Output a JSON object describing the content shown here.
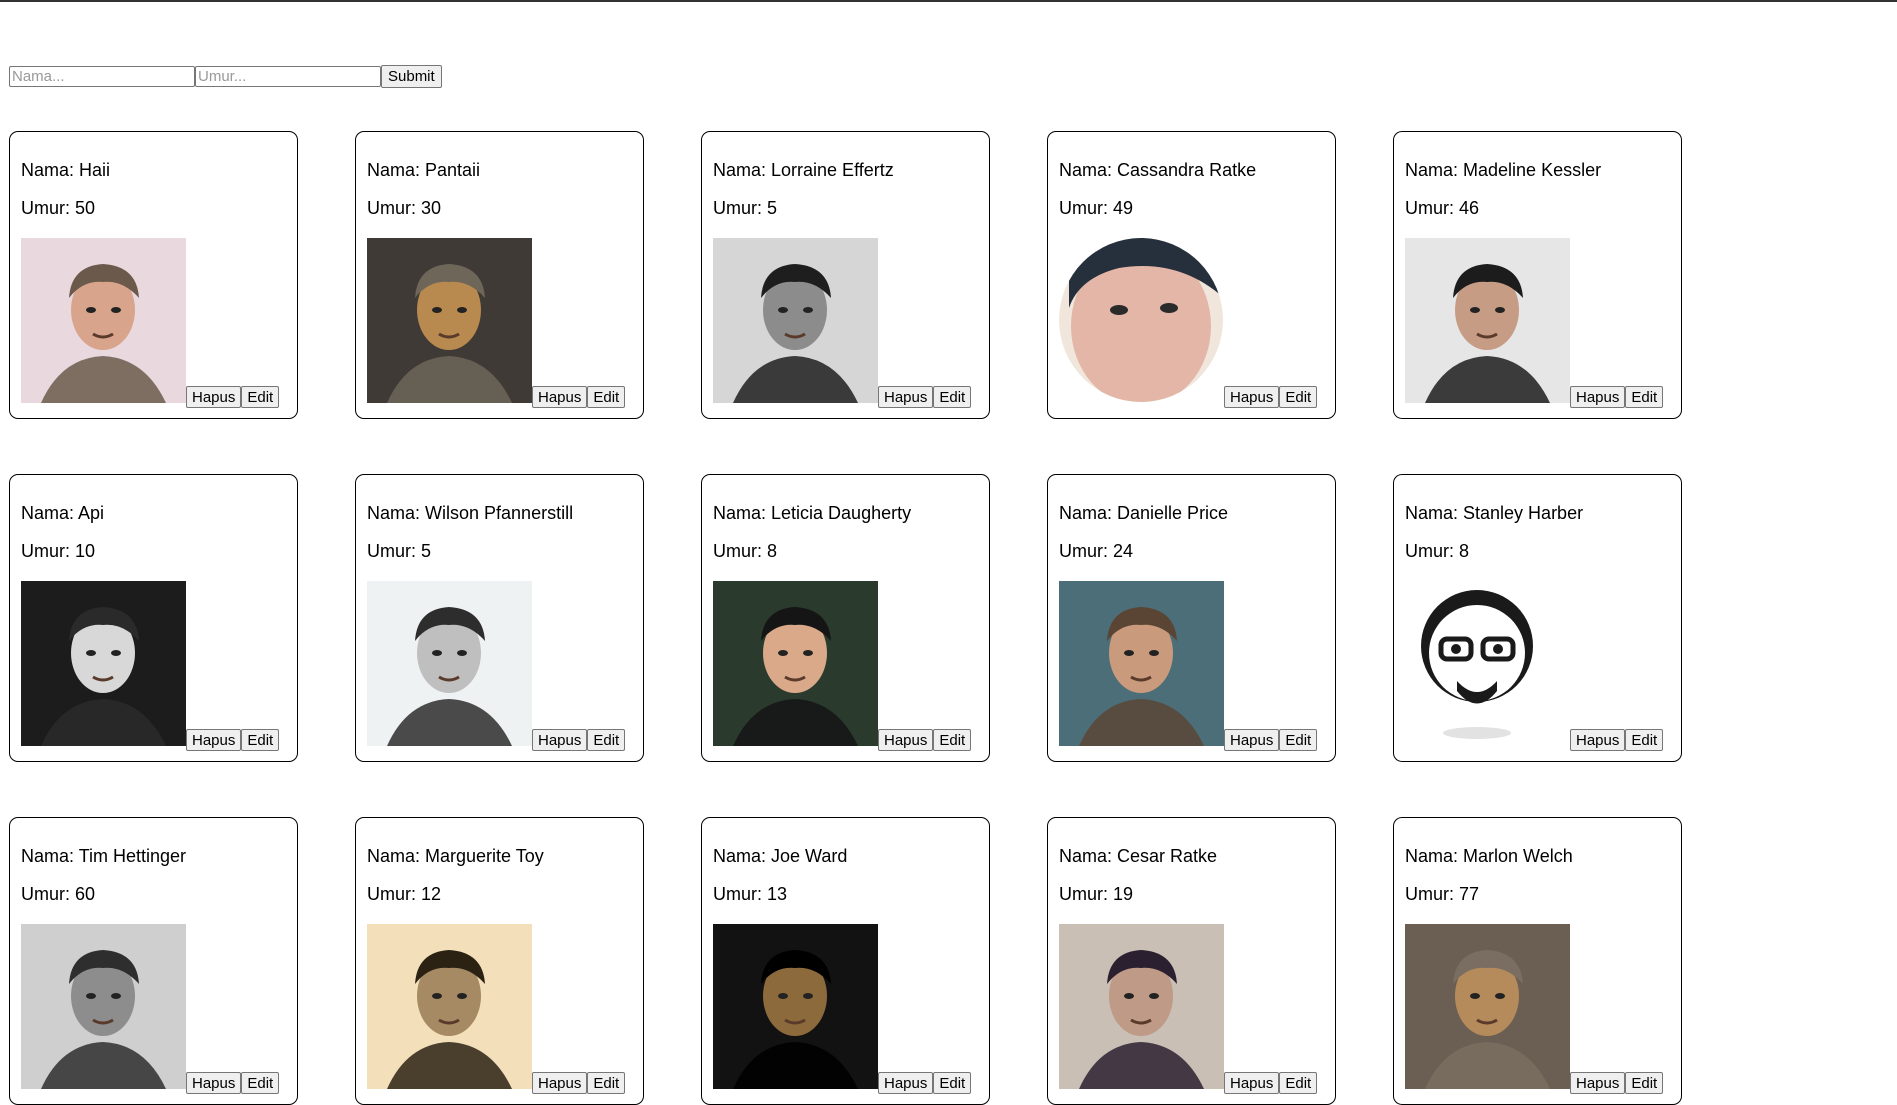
{
  "form": {
    "name_placeholder": "Nama...",
    "age_placeholder": "Umur...",
    "submit_label": "Submit"
  },
  "labels": {
    "delete": "Hapus",
    "edit": "Edit"
  },
  "people": [
    {
      "name": "Nama: Haii",
      "age": "Umur: 50",
      "bg": "#e9d9de",
      "face": "#d9a48c",
      "hair": "#6b5a4c",
      "shape": "square"
    },
    {
      "name": "Nama: Pantaii",
      "age": "Umur: 30",
      "bg": "#3f3a36",
      "face": "#b88a4f",
      "hair": "#6d6659",
      "shape": "square"
    },
    {
      "name": "Nama: Lorraine Effertz",
      "age": "Umur: 5",
      "bg": "#d6d6d6",
      "face": "#8c8c8c",
      "hair": "#1e1e1e",
      "shape": "square"
    },
    {
      "name": "Nama: Cassandra Ratke",
      "age": "Umur: 49",
      "bg": "#f1e6dc",
      "face": "#e3b6a7",
      "hair": "#26303c",
      "shape": "circle"
    },
    {
      "name": "Nama: Madeline Kessler",
      "age": "Umur: 46",
      "bg": "#e6e6e6",
      "face": "#c79c84",
      "hair": "#1c1c1c",
      "shape": "square"
    },
    {
      "name": "Nama: Api",
      "age": "Umur: 10",
      "bg": "#1c1c1c",
      "face": "#d8d8d8",
      "hair": "#2a2a2a",
      "shape": "square"
    },
    {
      "name": "Nama: Wilson Pfannerstill",
      "age": "Umur: 5",
      "bg": "#eef2f3",
      "face": "#bfbfbf",
      "hair": "#2d2d2d",
      "shape": "square"
    },
    {
      "name": "Nama: Leticia Daugherty",
      "age": "Umur: 8",
      "bg": "#2a3b2e",
      "face": "#d9a98a",
      "hair": "#151515",
      "shape": "square"
    },
    {
      "name": "Nama: Danielle Price",
      "age": "Umur: 24",
      "bg": "#4c6e78",
      "face": "#c99a7c",
      "hair": "#5a4535",
      "shape": "square"
    },
    {
      "name": "Nama: Stanley Harber",
      "age": "Umur: 8",
      "bg": "#ffffff",
      "face": "#ffffff",
      "hair": "#1a1a1a",
      "shape": "cartoon"
    },
    {
      "name": "Nama: Tim Hettinger",
      "age": "Umur: 60",
      "bg": "#cfcfcf",
      "face": "#8d8d8d",
      "hair": "#2e2e2e",
      "shape": "square"
    },
    {
      "name": "Nama: Marguerite Toy",
      "age": "Umur: 12",
      "bg": "#f3dfba",
      "face": "#a58a63",
      "hair": "#2b2214",
      "shape": "square"
    },
    {
      "name": "Nama: Joe Ward",
      "age": "Umur: 13",
      "bg": "#121212",
      "face": "#8d6a3c",
      "hair": "#000000",
      "shape": "square"
    },
    {
      "name": "Nama: Cesar Ratke",
      "age": "Umur: 19",
      "bg": "#c9bfb5",
      "face": "#bf9a86",
      "hair": "#2b2030",
      "shape": "square"
    },
    {
      "name": "Nama: Marlon Welch",
      "age": "Umur: 77",
      "bg": "#6b5e52",
      "face": "#b68b5b",
      "hair": "#7a6e62",
      "shape": "square"
    }
  ]
}
